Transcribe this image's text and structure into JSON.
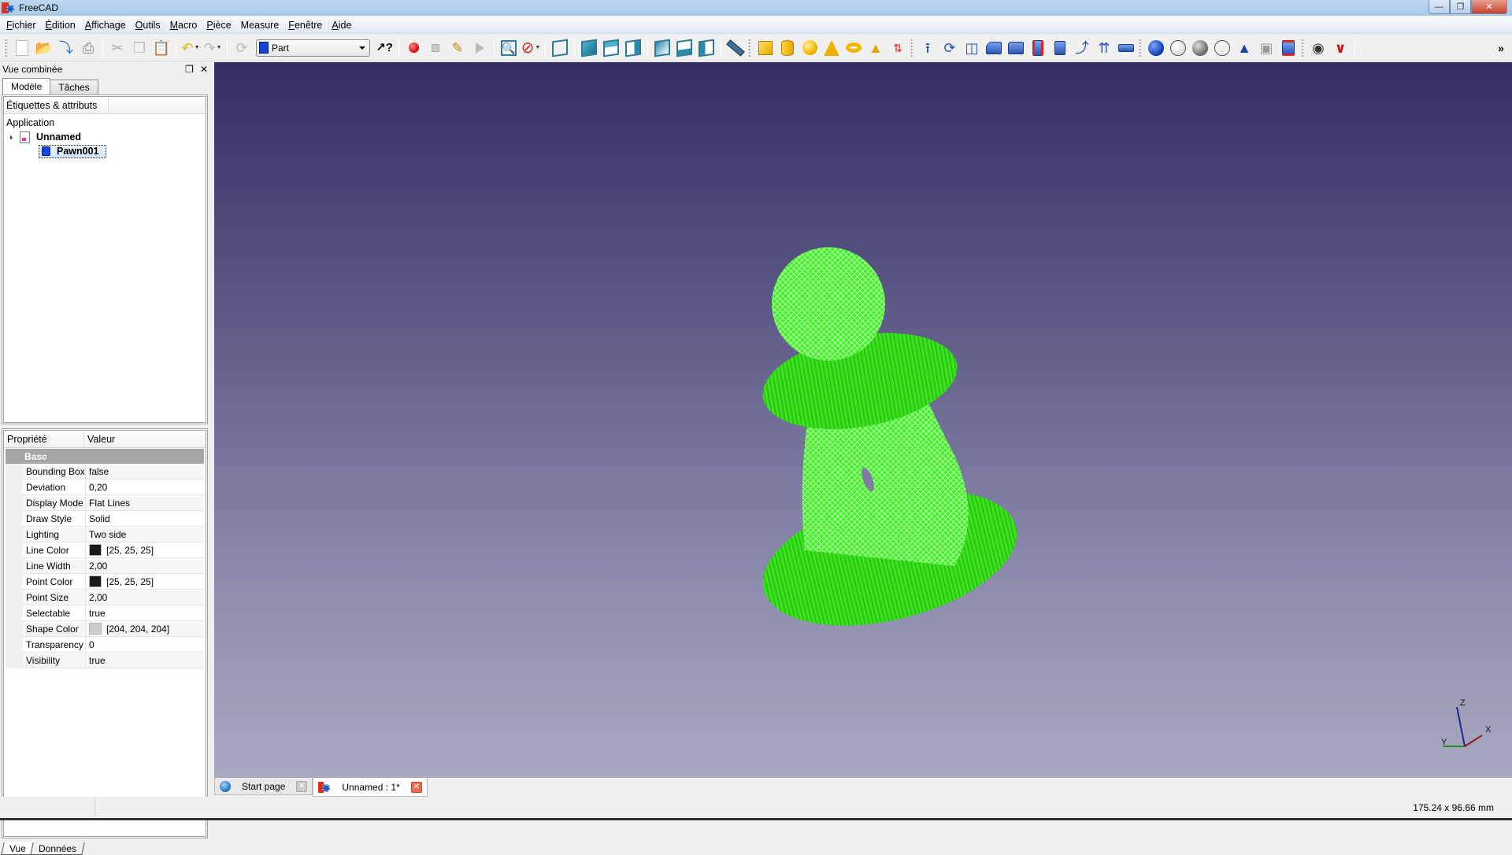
{
  "window": {
    "title": "FreeCAD",
    "buttons": {
      "minimize": "—",
      "restore": "❐",
      "close": "✕"
    }
  },
  "menubar": {
    "items": [
      {
        "label": "Fichier",
        "mnemonic": "F"
      },
      {
        "label": "Édition",
        "mnemonic": "É"
      },
      {
        "label": "Affichage",
        "mnemonic": "A"
      },
      {
        "label": "Outils",
        "mnemonic": "O"
      },
      {
        "label": "Macro",
        "mnemonic": "M"
      },
      {
        "label": "Pièce",
        "mnemonic": "P"
      },
      {
        "label": "Measure",
        "mnemonic": ""
      },
      {
        "label": "Fenêtre",
        "mnemonic": "F"
      },
      {
        "label": "Aide",
        "mnemonic": "A"
      }
    ]
  },
  "toolbar": {
    "workbench_selected": "Part",
    "file_icons": [
      "new-document-icon",
      "open-icon",
      "save-icon",
      "print-icon"
    ],
    "edit_icons": [
      "cut-icon",
      "copy-icon",
      "paste-icon"
    ],
    "undo_icons": [
      "undo-icon",
      "redo-icon",
      "refresh-icon"
    ],
    "whats_this_icon": "whats-this-icon",
    "macro_icons": [
      "macro-record-icon",
      "macro-stop-icon",
      "macro-edit-icon",
      "macro-run-icon"
    ],
    "view_icons": [
      "fit-all-icon",
      "draw-style-icon",
      "axonometric-view-icon",
      "front-view-icon",
      "top-view-icon",
      "right-view-icon",
      "rear-view-icon",
      "bottom-view-icon",
      "left-view-icon",
      "measure-distance-icon"
    ],
    "primitive_icons": [
      "box-icon",
      "cylinder-icon",
      "sphere-icon",
      "cone-icon",
      "torus-icon",
      "primitives-icon",
      "shape-builder-icon"
    ],
    "part_tool_icons": [
      "extrude-icon",
      "revolve-icon",
      "mirror-icon",
      "fillet-icon",
      "chamfer-icon",
      "ruled-surface-icon",
      "loft-icon",
      "sweep-icon",
      "offset-icon",
      "thickness-icon"
    ],
    "boolean_icons": [
      "boolean-icon",
      "cut-boolean-icon",
      "fusion-icon",
      "common-icon",
      "check-geometry-icon",
      "section-icon",
      "cross-sections-icon"
    ],
    "measure_icons": [
      "measure-linear-icon",
      "measure-angular-icon"
    ],
    "overflow": "»"
  },
  "left_panel": {
    "title": "Vue combinée",
    "tabs": [
      {
        "label": "Modèle",
        "active": true
      },
      {
        "label": "Tâches",
        "active": false
      }
    ],
    "tree": {
      "header": "Étiquettes & attributs",
      "root": "Application",
      "document": "Unnamed",
      "objects": [
        {
          "label": "Pawn001",
          "selected": true
        }
      ]
    },
    "properties": {
      "columns": [
        "Propriété",
        "Valeur"
      ],
      "group": "Base",
      "rows": [
        {
          "name": "Bounding Box",
          "value": "false"
        },
        {
          "name": "Deviation",
          "value": "0,20"
        },
        {
          "name": "Display Mode",
          "value": "Flat Lines"
        },
        {
          "name": "Draw Style",
          "value": "Solid"
        },
        {
          "name": "Lighting",
          "value": "Two side"
        },
        {
          "name": "Line Color",
          "value": "[25, 25, 25]",
          "swatch": "#191919"
        },
        {
          "name": "Line Width",
          "value": "2,00"
        },
        {
          "name": "Point Color",
          "value": "[25, 25, 25]",
          "swatch": "#191919"
        },
        {
          "name": "Point Size",
          "value": "2,00"
        },
        {
          "name": "Selectable",
          "value": "true"
        },
        {
          "name": "Shape Color",
          "value": "[204, 204, 204]",
          "swatch": "#cccccc"
        },
        {
          "name": "Transparency",
          "value": "0"
        },
        {
          "name": "Visibility",
          "value": "true"
        }
      ]
    },
    "bottom_tabs": [
      {
        "label": "Vue",
        "active": true
      },
      {
        "label": "Données",
        "active": false
      }
    ]
  },
  "viewport": {
    "model_color": "#33e61a",
    "axis_labels": {
      "x": "X",
      "y": "Y",
      "z": "Z"
    }
  },
  "document_tabs": [
    {
      "label": "Start page",
      "active": false
    },
    {
      "label": "Unnamed : 1*",
      "active": true
    }
  ],
  "statusbar": {
    "dimensions": "175.24 x 96.66 mm"
  }
}
